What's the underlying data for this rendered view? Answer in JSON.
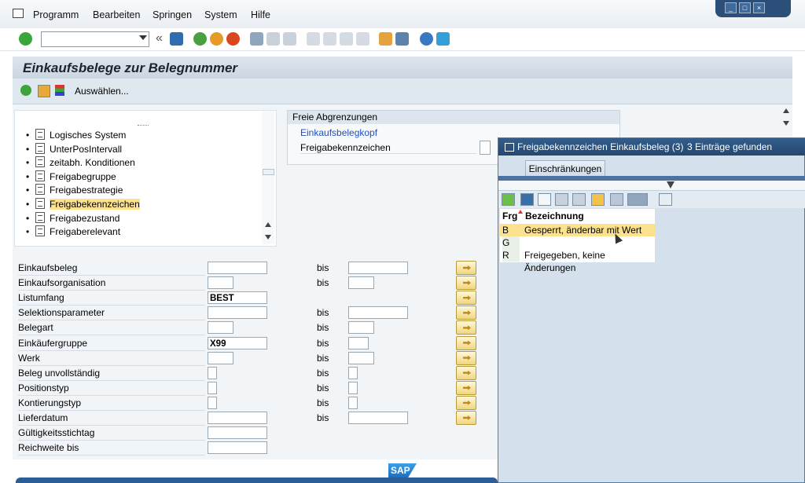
{
  "menubar": {
    "items": [
      "Programm",
      "Bearbeiten",
      "Springen",
      "System",
      "Hilfe"
    ],
    "accelerators": [
      "P",
      "B",
      "S",
      "S",
      "H"
    ]
  },
  "toolbar": {
    "command_field_value": "",
    "back_glyph": "«"
  },
  "screen": {
    "title": "Einkaufsbelege zur Belegnummer",
    "app_toolbar_button": "Auswählen..."
  },
  "tree": {
    "items": [
      {
        "label": "Logisches System",
        "selected": false
      },
      {
        "label": "UnterPosIntervall",
        "selected": false
      },
      {
        "label": "zeitabh. Konditionen",
        "selected": false
      },
      {
        "label": "Freigabegruppe",
        "selected": false
      },
      {
        "label": "Freigabestrategie",
        "selected": false
      },
      {
        "label": "Freigabekennzeichen",
        "selected": true
      },
      {
        "label": "Freigabezustand",
        "selected": false
      },
      {
        "label": "Freigaberelevant",
        "selected": false
      }
    ]
  },
  "free_area": {
    "header": "Freie Abgrenzungen",
    "link": "Einkaufsbelegkopf",
    "field_label": "Freigabekennzeichen"
  },
  "form": {
    "bis_label": "bis",
    "rows": [
      {
        "label": "Einkaufsbeleg",
        "value": "",
        "has_bis": true
      },
      {
        "label": "Einkaufsorganisation",
        "value": "",
        "has_bis": true
      },
      {
        "label": "Listumfang",
        "value": "BEST",
        "has_bis": false
      },
      {
        "label": "Selektionsparameter",
        "value": "",
        "has_bis": true
      },
      {
        "label": "Belegart",
        "value": "",
        "has_bis": true
      },
      {
        "label": "Einkäufergruppe",
        "value": "X99",
        "has_bis": true
      },
      {
        "label": "Werk",
        "value": "",
        "has_bis": true
      },
      {
        "label": "Beleg unvollständig",
        "value": "",
        "has_bis": true
      },
      {
        "label": "Positionstyp",
        "value": "",
        "has_bis": true
      },
      {
        "label": "Kontierungstyp",
        "value": "",
        "has_bis": true
      },
      {
        "label": "Lieferdatum",
        "value": "",
        "has_bis": true
      },
      {
        "label": "Gültigkeitsstichtag",
        "value": "",
        "has_bis": false
      },
      {
        "label": "Reichweite bis",
        "value": "",
        "has_bis": false
      }
    ]
  },
  "popup": {
    "title": "Freigabekennzeichen Einkaufsbeleg (3)",
    "result_count": "3 Einträge gefunden",
    "tab": "Einschränkungen",
    "columns": [
      "Frg",
      "Bezeichnung"
    ],
    "rows": [
      {
        "code": "B",
        "text": "Gesperrt, änderbar mit Wert",
        "selected": true
      },
      {
        "code": "G",
        "text": "",
        "selected": false
      },
      {
        "code": "R",
        "text": "Freigegeben, keine Änderungen",
        "selected": false
      }
    ]
  },
  "status": {
    "logo_text": "SAP"
  },
  "colors": {
    "selection": "#fce28f",
    "popup_title": "#24486f",
    "link": "#1f4fbf"
  }
}
